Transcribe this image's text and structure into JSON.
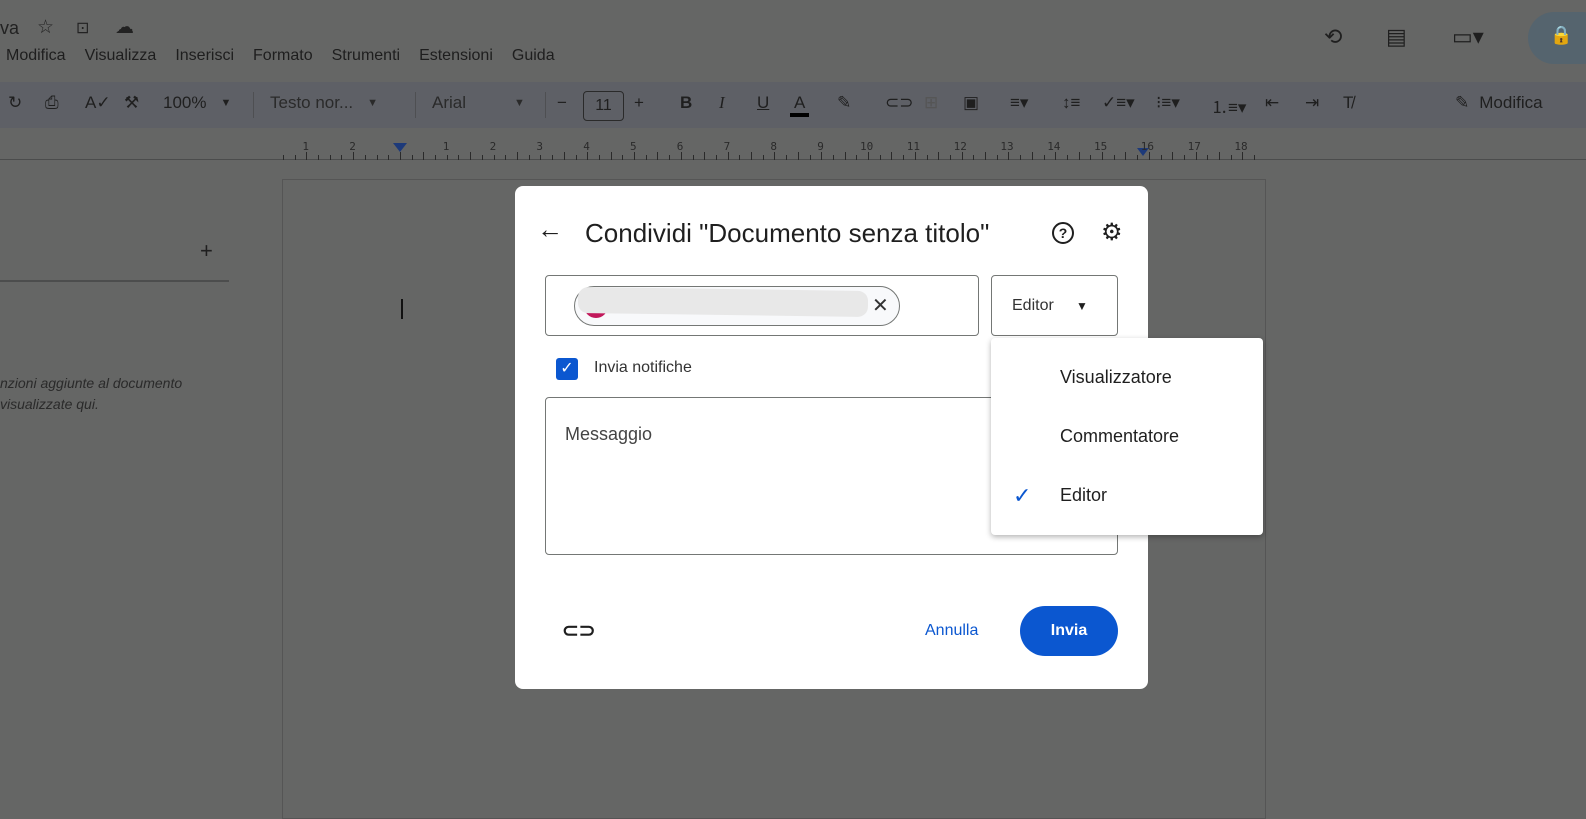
{
  "doc": {
    "title_fragment": "va",
    "menu": [
      "Modifica",
      "Visualizza",
      "Inserisci",
      "Formato",
      "Strumenti",
      "Estensioni",
      "Guida"
    ]
  },
  "toolbar": {
    "zoom": "100%",
    "style": "Testo nor...",
    "font": "Arial",
    "font_size": "11",
    "edit_mode": "Modifica"
  },
  "ruler": {
    "left": [
      "2",
      "1"
    ],
    "right": [
      "1",
      "2",
      "3",
      "4",
      "5",
      "6",
      "7",
      "8",
      "9",
      "10",
      "11",
      "12",
      "13",
      "14",
      "15",
      "16",
      "17",
      "18"
    ]
  },
  "sidebar": {
    "add": "+",
    "empty_line1": "nzioni aggiunte al documento",
    "empty_line2": "visualizzate qui."
  },
  "dialog": {
    "title": "Condividi \"Documento senza titolo\"",
    "role": "Editor",
    "notify_label": "Invia notifiche",
    "notify_checked": true,
    "message_placeholder": "Messaggio",
    "cancel": "Annulla",
    "send": "Invia"
  },
  "role_menu": {
    "items": [
      "Visualizzatore",
      "Commentatore",
      "Editor"
    ],
    "selected": "Editor"
  },
  "colors": {
    "accent": "#0b57d0",
    "avatar": "#c2185b",
    "overlay": "#656665"
  }
}
